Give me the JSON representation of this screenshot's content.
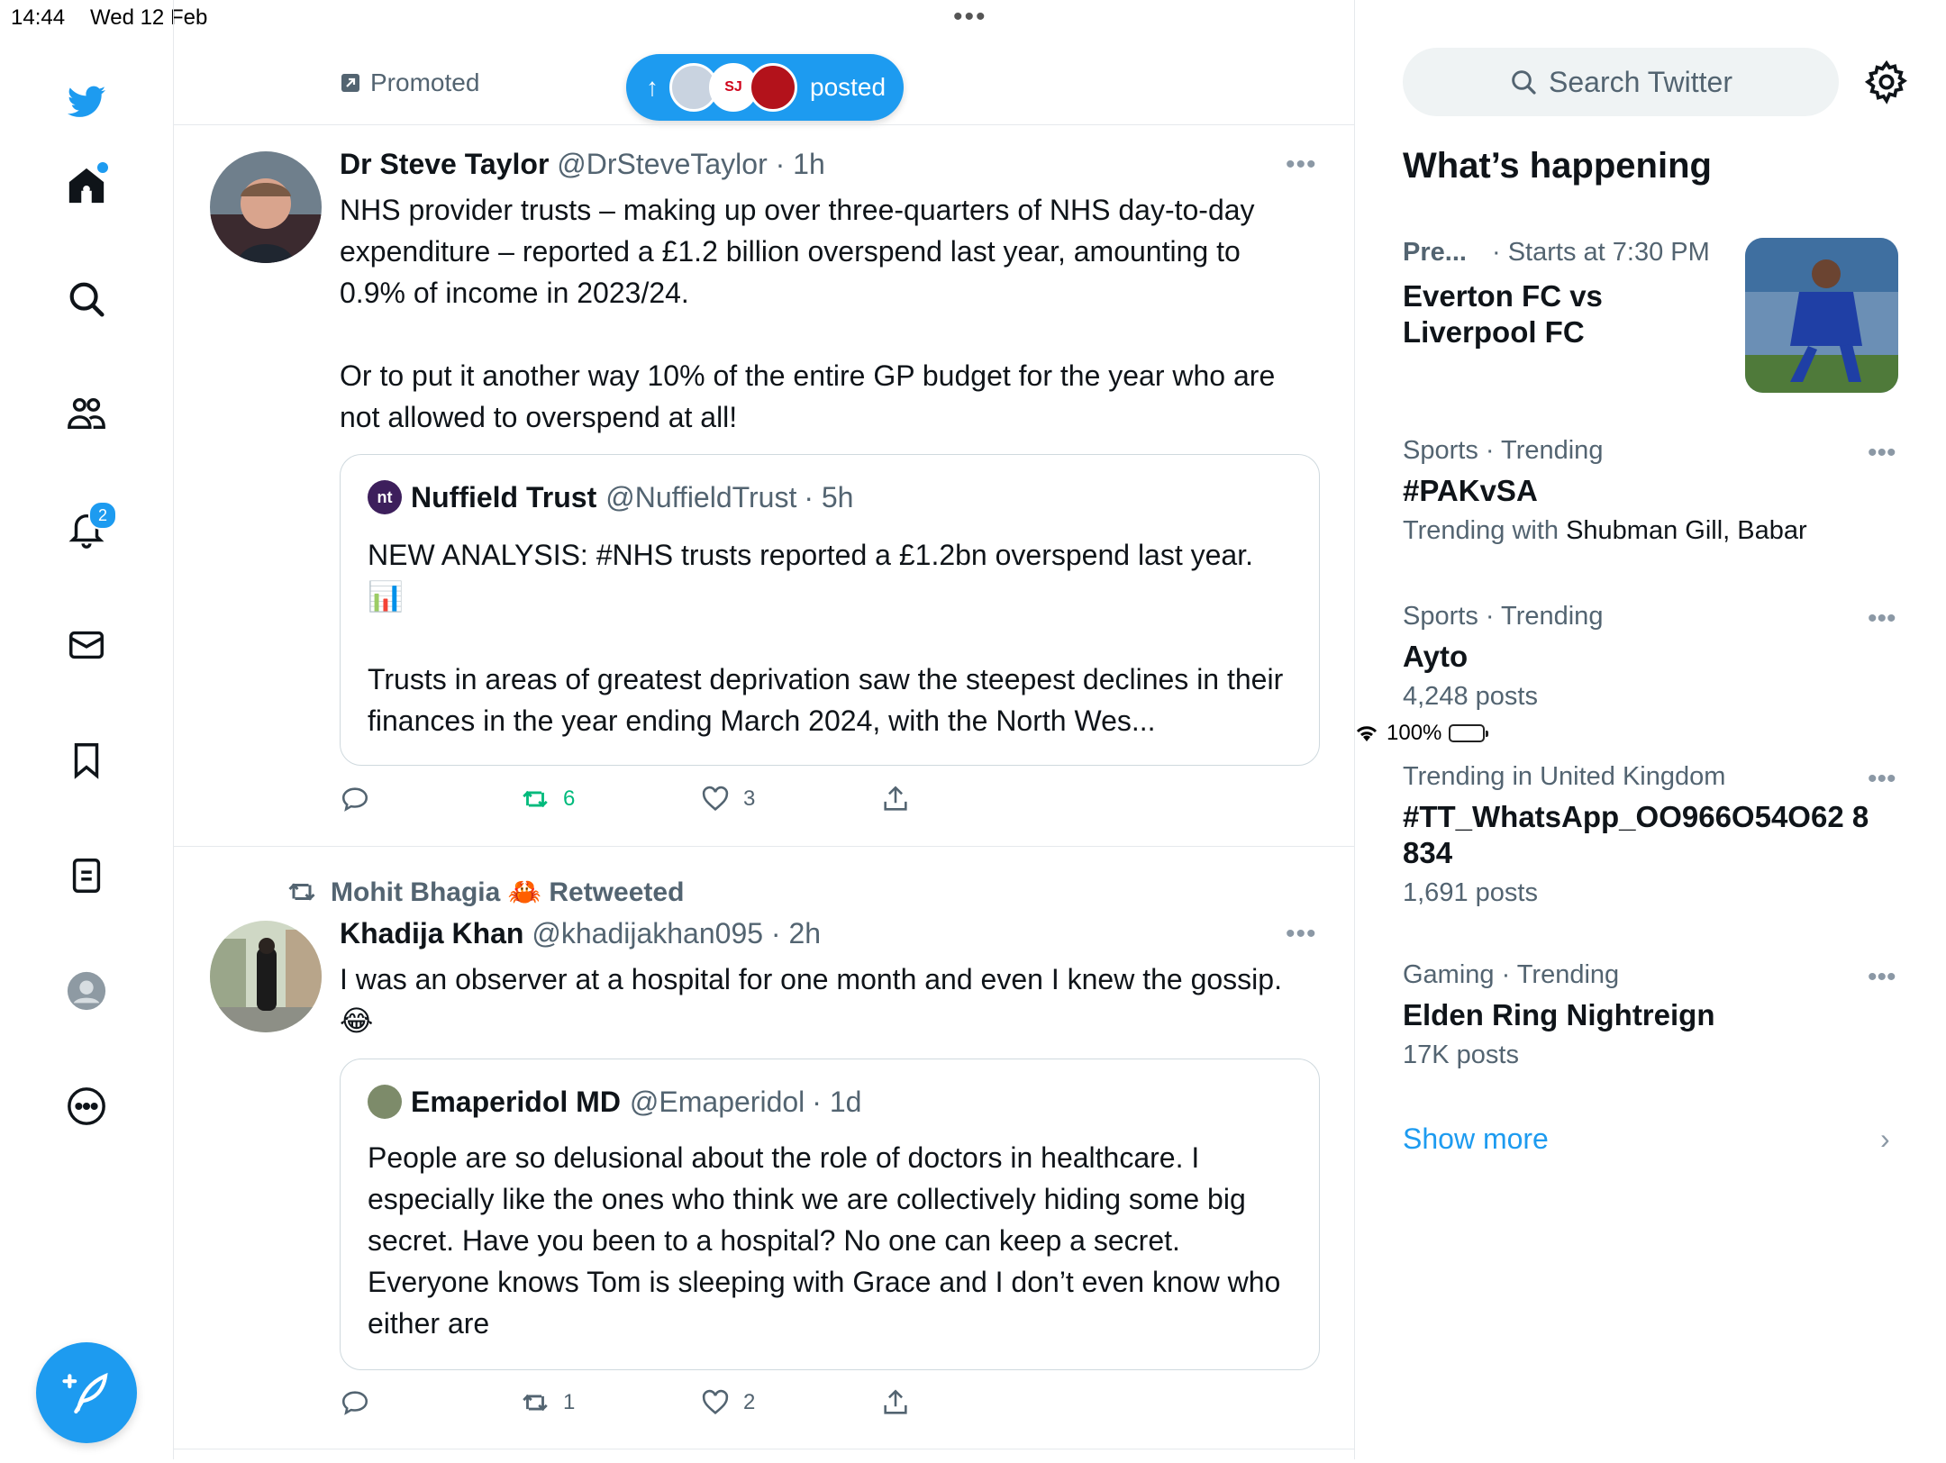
{
  "status_bar": {
    "time": "14:44",
    "date": "Wed 12 Feb",
    "battery": "100%"
  },
  "nav": {
    "notifications_badge": "2",
    "items": [
      "home",
      "search",
      "communities",
      "notifications",
      "messages",
      "bookmarks",
      "lists",
      "profile",
      "more"
    ]
  },
  "feed": {
    "promoted_label": "Promoted",
    "new_posts_pill": {
      "label": "posted",
      "avatar_text": "SJ"
    },
    "tweets": [
      {
        "name": "Dr Steve Taylor",
        "handle": "@DrSteveTaylor",
        "time": "· 1h",
        "text_1": "NHS provider trusts – making up over three-quarters of NHS day-to-day expenditure – reported a £1.2 billion overspend last year, amounting to 0.9% of income in 2023/24.",
        "text_2": "Or to put it another way 10% of the entire GP budget for the year who are not allowed to overspend at all!",
        "quote": {
          "avatar_text": "nt",
          "name": "Nuffield Trust",
          "handle": "@NuffieldTrust",
          "time": "· 5h",
          "text_1": "NEW ANALYSIS: #NHS trusts reported a £1.2bn overspend last year. 📊",
          "text_2": "Trusts in areas of greatest deprivation saw the steepest declines in their finances in the year ending March 2024, with the North Wes..."
        },
        "actions": {
          "replies": "",
          "retweets": "6",
          "likes": "3"
        }
      },
      {
        "retweeted_by": "Mohit Bhagia 🦀 Retweeted",
        "name": "Khadija Khan",
        "handle": "@khadijakhan095",
        "time": "· 2h",
        "text_1": "I was an observer at a hospital for one month and even I knew the gossip. 😂",
        "quote": {
          "name": "Emaperidol MD",
          "handle": "@Emaperidol",
          "time": "· 1d",
          "text_1": "People are so delusional about the role of doctors in healthcare. I especially like the ones who think we are collectively hiding some big secret. Have you been to a hospital? No one can keep a secret. Everyone knows Tom is sleeping with Grace and I don’t even know who either are"
        },
        "actions": {
          "replies": "",
          "retweets": "1",
          "likes": "2"
        }
      }
    ]
  },
  "sidebar": {
    "search_placeholder": "Search Twitter",
    "section_title": "What’s happening",
    "featured": {
      "context": "Pre...",
      "time": "· Starts at 7:30 PM",
      "title": "Everton FC vs Liverpool FC"
    },
    "trends": [
      {
        "context": "Sports · Trending",
        "title": "#PAKvSA",
        "sub_prefix": "Trending with ",
        "sub_bold": "Shubman Gill, Babar"
      },
      {
        "context": "Sports · Trending",
        "title": "Ayto",
        "sub_prefix": "4,248 posts",
        "sub_bold": ""
      },
      {
        "context": "Trending in United Kingdom",
        "title": "#TT_WhatsApp_OO966O54O62 8834",
        "sub_prefix": "1,691 posts",
        "sub_bold": ""
      },
      {
        "context": "Gaming · Trending",
        "title": "Elden Ring Nightreign",
        "sub_prefix": "17K posts",
        "sub_bold": ""
      }
    ],
    "show_more": "Show more"
  },
  "colors": {
    "accent": "#1d9bf0",
    "retweet_active": "#00ba7c",
    "muted": "#536471"
  }
}
